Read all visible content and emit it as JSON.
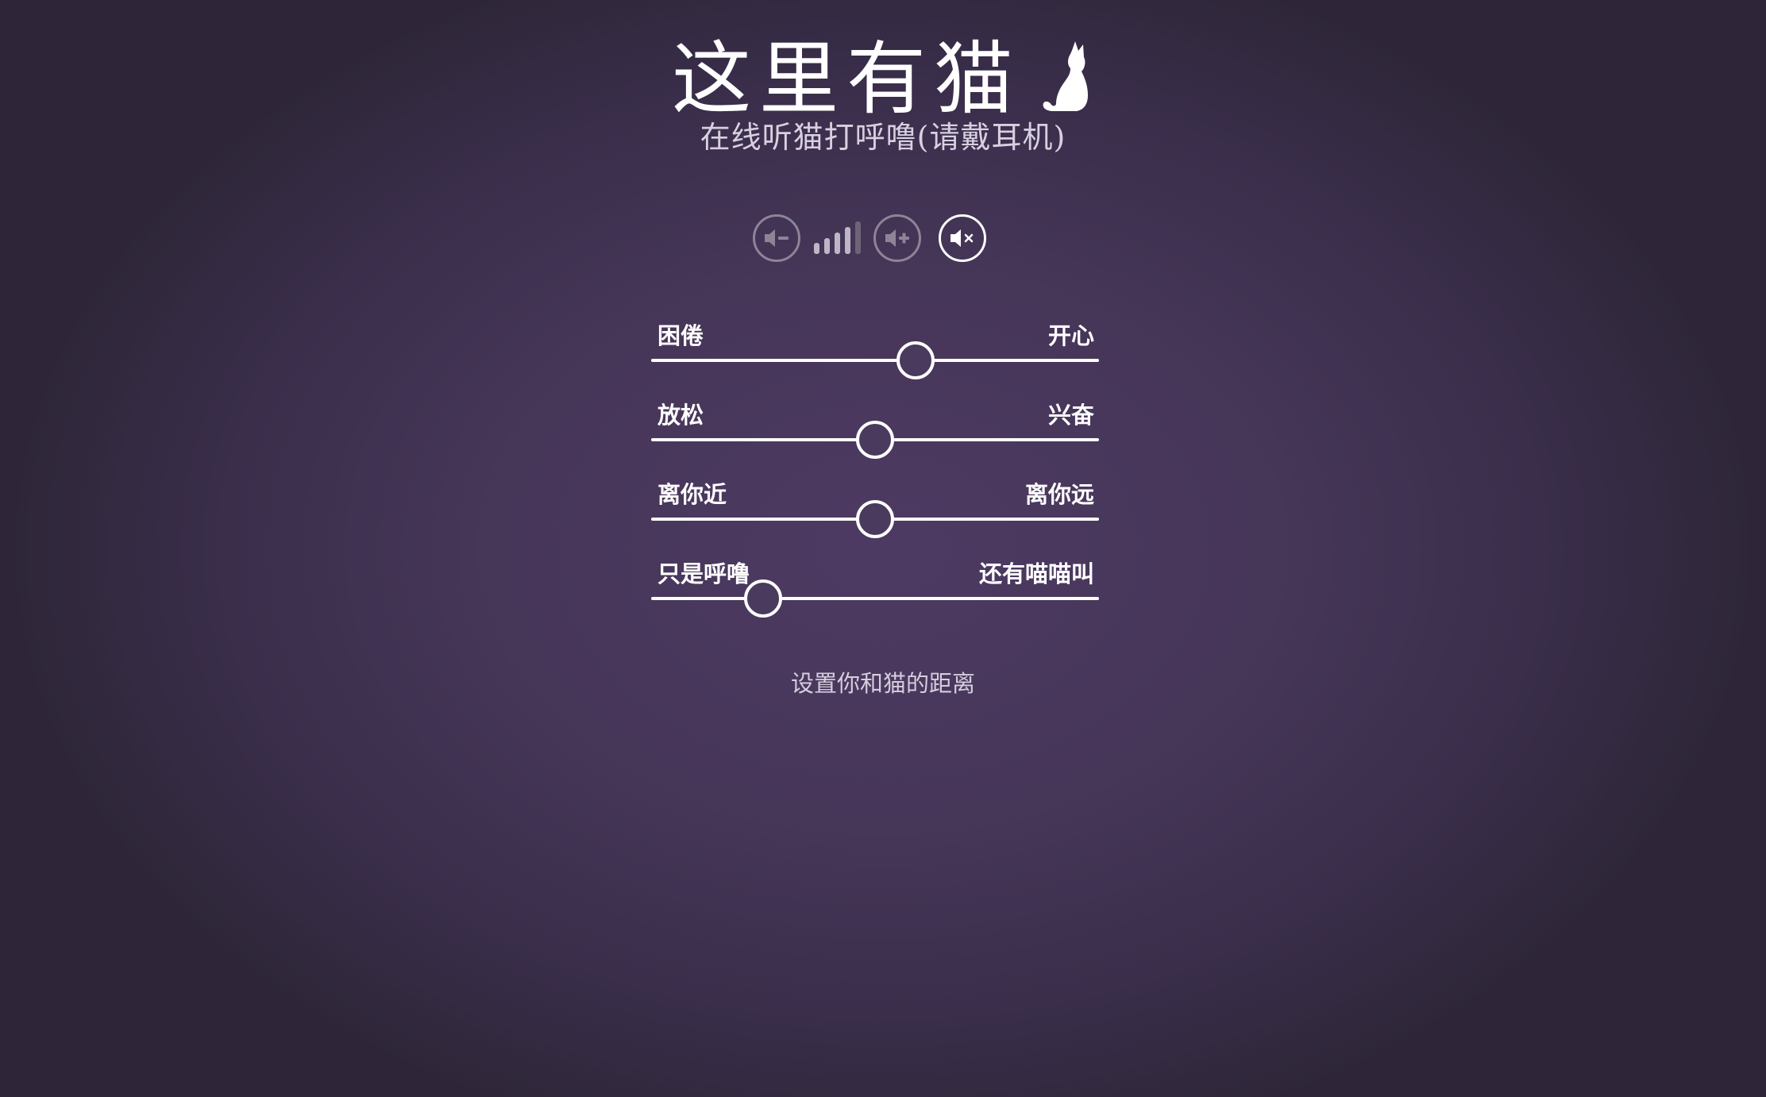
{
  "header": {
    "title": "这里有猫",
    "subtitle": "在线听猫打呼噜(请戴耳机)",
    "logo_icon": "cat-silhouette-icon"
  },
  "volume": {
    "decrease_icon": "volume-down-icon",
    "increase_icon": "volume-up-icon",
    "mute_icon": "volume-mute-icon",
    "level": 4,
    "max_level": 5,
    "muted": true
  },
  "sliders": [
    {
      "left_label": "困倦",
      "right_label": "开心",
      "value": 0.59
    },
    {
      "left_label": "放松",
      "right_label": "兴奋",
      "value": 0.5
    },
    {
      "left_label": "离你近",
      "right_label": "离你远",
      "value": 0.5
    },
    {
      "left_label": "只是呼噜",
      "right_label": "还有喵喵叫",
      "value": 0.25
    }
  ],
  "footer": {
    "distance_link": "设置你和猫的距离"
  },
  "colors": {
    "background_center": "#4d3a63",
    "background_edge": "#2e2638",
    "text": "#ffffff",
    "muted_text": "#d4cddd",
    "inactive_button": "#8d8498"
  }
}
